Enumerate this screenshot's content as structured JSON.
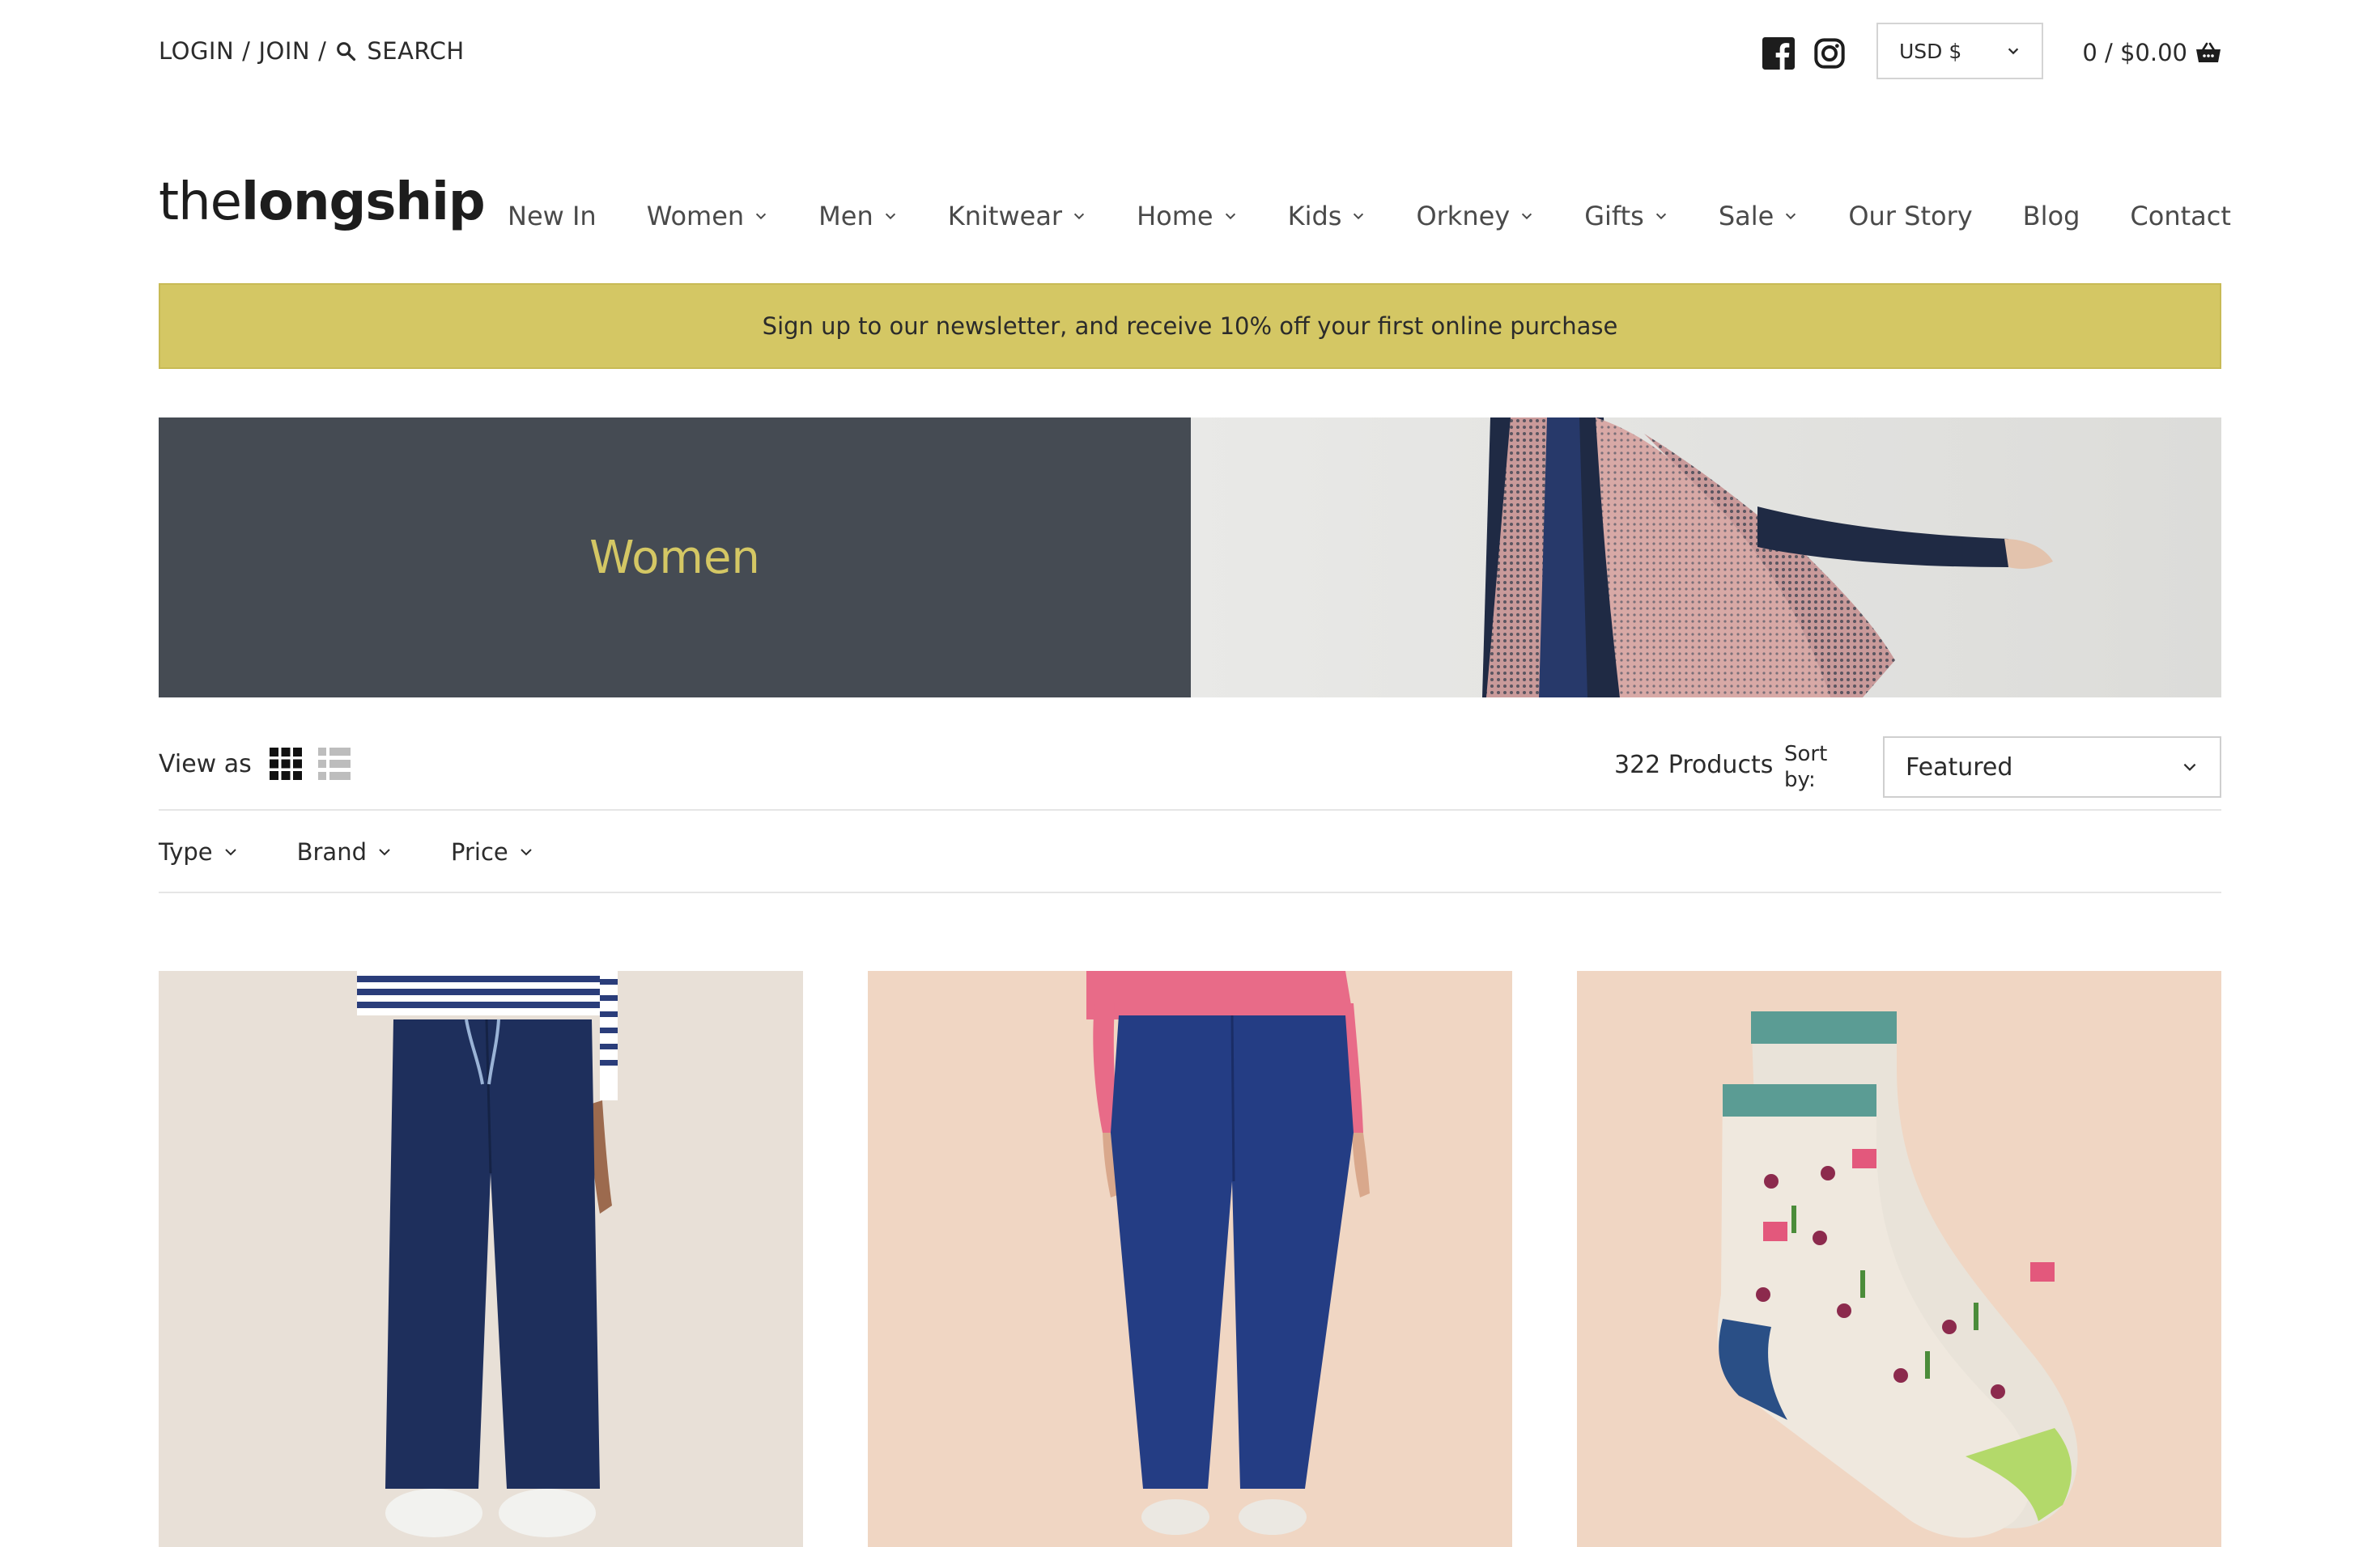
{
  "topbar": {
    "login": "LOGIN",
    "join": "JOIN",
    "search": "SEARCH",
    "currency": "USD $",
    "cart": "0 / $0.00"
  },
  "icons": {
    "search": "search-icon",
    "facebook": "facebook-icon",
    "instagram": "instagram-icon",
    "cart": "basket-icon",
    "chevron": "chevron-down-icon"
  },
  "logo": {
    "light": "the",
    "bold": "longship"
  },
  "nav": {
    "items": [
      {
        "label": "New In"
      },
      {
        "label": "Women"
      },
      {
        "label": "Men"
      },
      {
        "label": "Knitwear"
      },
      {
        "label": "Home"
      },
      {
        "label": "Kids"
      },
      {
        "label": "Orkney"
      },
      {
        "label": "Gifts"
      },
      {
        "label": "Sale"
      },
      {
        "label": "Our Story"
      },
      {
        "label": "Blog"
      },
      {
        "label": "Contact"
      }
    ]
  },
  "newsletter": {
    "text": "Sign up to our newsletter, and receive 10% off your first online purchase"
  },
  "hero": {
    "title": "Women"
  },
  "toolbar": {
    "view_as": "View as",
    "count": "322 Products",
    "sort_label": "Sort by:",
    "sort_value": "Featured"
  },
  "filters": [
    {
      "label": "Type"
    },
    {
      "label": "Brand"
    },
    {
      "label": "Price"
    }
  ],
  "colors": {
    "accent": "#d4c764",
    "hero_bg": "#454b53",
    "text": "#2b2b2b"
  }
}
